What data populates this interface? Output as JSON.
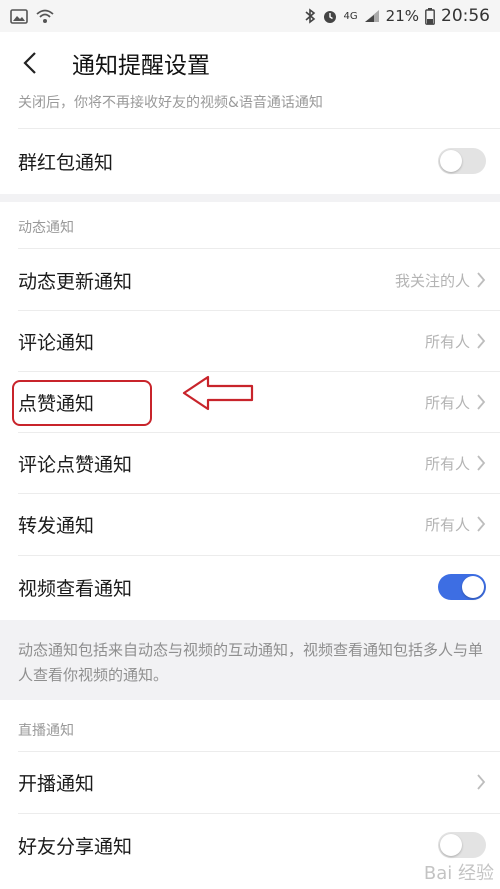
{
  "status_bar": {
    "battery": "21%",
    "time": "20:56",
    "network": "4G"
  },
  "header": {
    "title": "通知提醒设置"
  },
  "top_hint": "关闭后，你将不再接收好友的视频&语音通话通知",
  "rows_top": {
    "red_packet": {
      "label": "群红包通知",
      "enabled": false
    }
  },
  "sections": {
    "dynamic": {
      "title": "动态通知",
      "items": [
        {
          "label": "动态更新通知",
          "value": "我关注的人"
        },
        {
          "label": "评论通知",
          "value": "所有人"
        },
        {
          "label": "点赞通知",
          "value": "所有人"
        },
        {
          "label": "评论点赞通知",
          "value": "所有人"
        },
        {
          "label": "转发通知",
          "value": "所有人"
        }
      ],
      "video_view": {
        "label": "视频查看通知",
        "enabled": true
      },
      "description": "动态通知包括来自动态与视频的互动通知，视频查看通知包括多人与单人查看你视频的通知。"
    },
    "live": {
      "title": "直播通知",
      "start_live": {
        "label": "开播通知"
      },
      "friend_share": {
        "label": "好友分享通知",
        "enabled": false
      }
    }
  },
  "watermark": "Bai 经验",
  "colors": {
    "toggle_on": "#3d6ee3",
    "toggle_off": "#e3e3e3",
    "annotation_red": "#c8242b",
    "section_gray": "#f2f2f4"
  }
}
